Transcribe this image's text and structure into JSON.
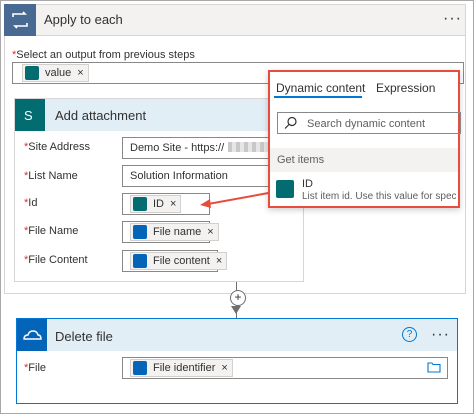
{
  "apply_to_each": {
    "title": "Apply to each",
    "more": "···",
    "select_label": "Select an output from previous steps",
    "required_mark": "*",
    "value_token": "value",
    "remove": "×"
  },
  "add_attachment": {
    "title": "Add attachment",
    "fields": {
      "site_address": {
        "label": "Site Address",
        "value": "Demo Site - https://"
      },
      "list_name": {
        "label": "List Name",
        "value": "Solution Information"
      },
      "id": {
        "label": "Id",
        "token": "ID"
      },
      "file_name": {
        "label": "File Name",
        "token": "File name"
      },
      "file_content": {
        "label": "File Content",
        "token": "File content"
      }
    }
  },
  "dynamic_panel": {
    "tab_dynamic": "Dynamic content",
    "tab_expression": "Expression",
    "search_placeholder": "Search dynamic content",
    "section": "Get items",
    "item_title": "ID",
    "item_desc": "List item id. Use this value for specifying"
  },
  "delete_file": {
    "title": "Delete file",
    "more": "···",
    "help": "?",
    "field_label": "File",
    "token": "File identifier"
  },
  "add_step": "+",
  "colors": {
    "accent": "#0078d4",
    "highlight": "#e84c3d",
    "sharepoint": "#036c70",
    "onedrive": "#0364b8"
  },
  "icons": {
    "loop": "loop-icon",
    "sharepoint": "sharepoint-icon",
    "onedrive": "onedrive-icon",
    "search": "search-icon",
    "folder": "folder-icon"
  }
}
